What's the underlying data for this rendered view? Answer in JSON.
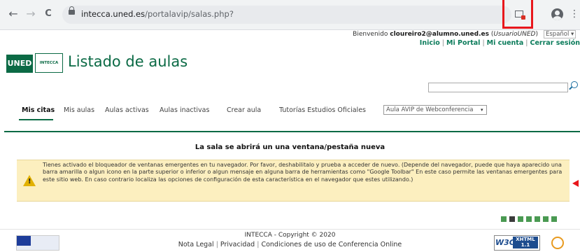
{
  "browser": {
    "back": "←",
    "forward": "→",
    "reload": "C",
    "url_host": "intecca.uned.es",
    "url_path": "/portalavip/salas.php?",
    "menu": "⋮"
  },
  "userbar": {
    "greeting": "Bienvenido",
    "email": "cloureiro2@alumno.uned.es",
    "role": "UsuarioUNED",
    "language": "Español ▾",
    "links": [
      "Inicio",
      "Mi Portal",
      "Mi cuenta",
      "Cerrar sesión"
    ]
  },
  "header": {
    "logo_uned": "UNED",
    "logo_intecca": "INTECCA",
    "title": "Listado de aulas"
  },
  "nav": {
    "tabs": [
      "Mis citas",
      "Mis aulas",
      "Aulas activas",
      "Aulas inactivas",
      "Crear aula",
      "Tutorías Estudios Oficiales"
    ],
    "select_value": "Aula AVIP de Webconferencia",
    "select_arrow": "▾"
  },
  "message": {
    "heading": "La sala se abrirá un una ventana/pestaña nueva",
    "warning_icon": "!",
    "body": "Tienes activado el bloqueador de ventanas emergentes en tu navegador. Por favor, deshabilitalo y prueba a acceder de nuevo. (Depende del navegador, puede que haya aparecido una barra amarilla o algun icono en la parte superior o inferior o algun mensaje en alguna barra de herramientas como \"Google Toolbar\" En este caso permite las ventanas emergentes para este sitio web. En caso contrario localiza las opciones de configuración de esta característica en el navegador que estes utilizando.)"
  },
  "footer": {
    "copyright": "INTECCA - Copyright © 2020",
    "links": [
      "Nota Legal",
      "Privacidad",
      "Condiciones de uso de Conferencia Online"
    ],
    "w3c": "W3C",
    "xhtml": "XHTML 1.1"
  },
  "colors": {
    "brand_green": "#0b6a45",
    "highlight_red": "#e8171c",
    "warning_bg": "#fcefbf"
  }
}
